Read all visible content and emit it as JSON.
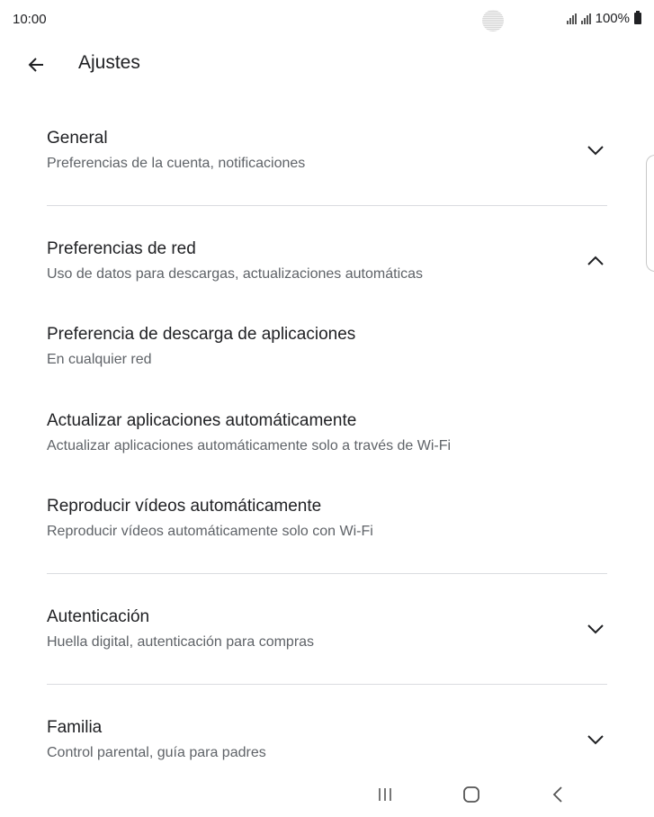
{
  "status_bar": {
    "time": "10:00",
    "battery": "100%"
  },
  "app_bar": {
    "title": "Ajustes",
    "back_icon": "arrow-back-icon"
  },
  "sections": [
    {
      "title": "General",
      "subtitle": "Preferencias de la cuenta, notificaciones",
      "expanded": false,
      "icon": "chevron-down-icon"
    },
    {
      "title": "Preferencias de red",
      "subtitle": "Uso de datos para descargas, actualizaciones automáticas",
      "expanded": true,
      "icon": "chevron-up-icon",
      "items": [
        {
          "title": "Preferencia de descarga de aplicaciones",
          "subtitle": "En cualquier red"
        },
        {
          "title": "Actualizar aplicaciones automáticamente",
          "subtitle": "Actualizar aplicaciones automáticamente solo a través de Wi-Fi"
        },
        {
          "title": "Reproducir vídeos automáticamente",
          "subtitle": "Reproducir vídeos automáticamente solo con Wi-Fi"
        }
      ]
    },
    {
      "title": "Autenticación",
      "subtitle": "Huella digital, autenticación para compras",
      "expanded": false,
      "icon": "chevron-down-icon"
    },
    {
      "title": "Familia",
      "subtitle": "Control parental, guía para padres",
      "expanded": false,
      "icon": "chevron-down-icon"
    }
  ],
  "nav_bar": {
    "recents_icon": "recents-icon",
    "home_icon": "home-icon",
    "back_icon": "nav-back-icon"
  },
  "colors": {
    "text_primary": "#202124",
    "text_secondary": "#5f6368",
    "divider": "#dadce0"
  }
}
